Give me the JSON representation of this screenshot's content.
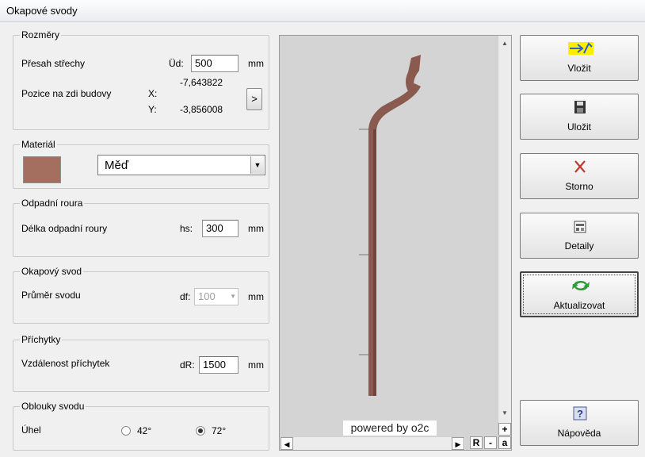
{
  "window": {
    "title": "Okapové svody"
  },
  "rozmery": {
    "legend": "Rozměry",
    "presah_label": "Přesah střechy",
    "presah_param": "Üd:",
    "presah_value": "500",
    "presah_unit": "mm",
    "pozice_label": "Pozice na zdi budovy",
    "x_label": "X:",
    "x_value": "-7,643822",
    "y_label": "Y:",
    "y_value": "-3,856008",
    "arrow_button": ">"
  },
  "material": {
    "legend": "Materiál",
    "selected": "Měď",
    "swatch_color": "#a56f5f"
  },
  "odpadni": {
    "legend": "Odpadní roura",
    "label": "Délka odpadní roury",
    "param": "hs:",
    "value": "300",
    "unit": "mm"
  },
  "okapovy": {
    "legend": "Okapový svod",
    "label": "Průměr svodu",
    "param": "df:",
    "value": "100",
    "unit": "mm"
  },
  "prichytky": {
    "legend": "Příchytky",
    "label": "Vzdálenost příchytek",
    "param": "dR:",
    "value": "1500",
    "unit": "mm"
  },
  "oblouky": {
    "legend": "Oblouky svodu",
    "label": "Úhel",
    "opt1": "42°",
    "opt2": "72°",
    "selected": "72°"
  },
  "viewer": {
    "powered": "powered by o2c",
    "btn_plus": "+",
    "btn_r": "R",
    "btn_minus": "-",
    "btn_a": "a",
    "pipe_color": "#8a5a4f"
  },
  "buttons": {
    "vlozit": "Vložit",
    "ulozit": "Uložit",
    "storno": "Storno",
    "detaily": "Detaily",
    "aktualizovat": "Aktualizovat",
    "napoveda": "Nápověda"
  }
}
